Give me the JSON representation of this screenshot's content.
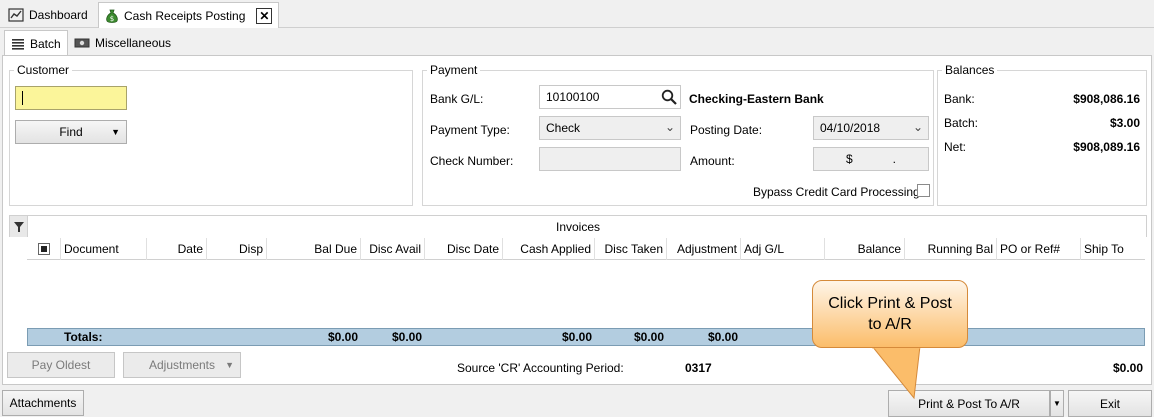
{
  "tabs": {
    "dashboard": "Dashboard",
    "cash_receipts": "Cash Receipts Posting",
    "close": "✕"
  },
  "subtabs": {
    "batch": "Batch",
    "misc": "Miscellaneous"
  },
  "customer": {
    "legend": "Customer",
    "input_value": "",
    "find_label": "Find"
  },
  "payment": {
    "legend": "Payment",
    "bank_gl_label": "Bank G/L:",
    "bank_gl_value": "10100100",
    "bank_name": "Checking-Eastern Bank",
    "payment_type_label": "Payment Type:",
    "payment_type_value": "Check",
    "posting_date_label": "Posting Date:",
    "posting_date_value": "04/10/2018",
    "check_number_label": "Check Number:",
    "check_number_value": "",
    "amount_label": "Amount:",
    "amount_value": "$            .",
    "bypass_label": "Bypass Credit Card Processing"
  },
  "balances": {
    "legend": "Balances",
    "bank_label": "Bank:",
    "bank_value": "$908,086.16",
    "batch_label": "Batch:",
    "batch_value": "$3.00",
    "net_label": "Net:",
    "net_value": "$908,089.16"
  },
  "invoices": {
    "title": "Invoices",
    "columns": [
      "Document",
      "Date",
      "Disp",
      "Bal Due",
      "Disc Avail",
      "Disc Date",
      "Cash Applied",
      "Disc Taken",
      "Adjustment",
      "Adj G/L",
      "Balance",
      "Running Bal",
      "PO or Ref#",
      "Ship To"
    ],
    "totals_label": "Totals:",
    "totals": {
      "bal_due": "$0.00",
      "disc_avail": "$0.00",
      "cash_applied": "$0.00",
      "disc_taken": "$0.00",
      "adjustment": "$0.00"
    }
  },
  "footer": {
    "pay_oldest": "Pay Oldest",
    "adjustments": "Adjustments",
    "period_label": "Source 'CR' Accounting Period:",
    "period_value": "0317",
    "total_value": "$0.00",
    "attachments": "Attachments",
    "print_post": "Print & Post To A/R",
    "exit": "Exit"
  },
  "callout": {
    "text_line1": "Click Print & Post",
    "text_line2": "to A/R"
  }
}
